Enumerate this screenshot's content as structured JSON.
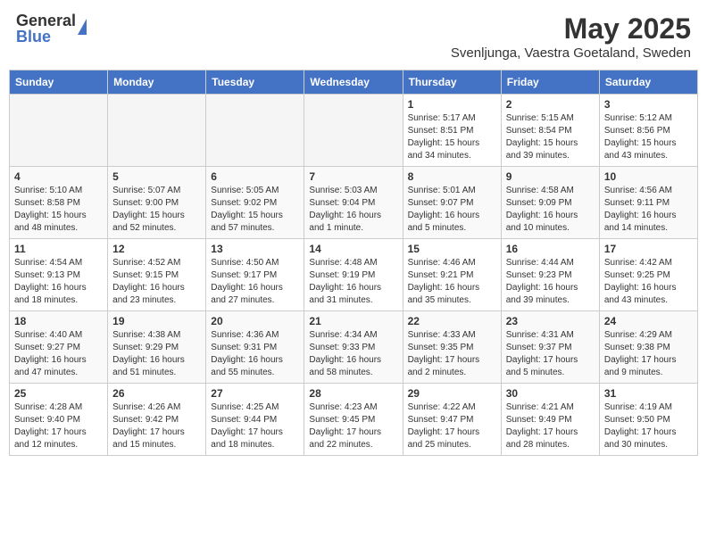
{
  "header": {
    "logo_general": "General",
    "logo_blue": "Blue",
    "month_title": "May 2025",
    "subtitle": "Svenljunga, Vaestra Goetaland, Sweden"
  },
  "weekdays": [
    "Sunday",
    "Monday",
    "Tuesday",
    "Wednesday",
    "Thursday",
    "Friday",
    "Saturday"
  ],
  "weeks": [
    [
      {
        "day": "",
        "empty": true
      },
      {
        "day": "",
        "empty": true
      },
      {
        "day": "",
        "empty": true
      },
      {
        "day": "",
        "empty": true
      },
      {
        "day": "1",
        "sunrise": "Sunrise: 5:17 AM",
        "sunset": "Sunset: 8:51 PM",
        "daylight": "Daylight: 15 hours and 34 minutes."
      },
      {
        "day": "2",
        "sunrise": "Sunrise: 5:15 AM",
        "sunset": "Sunset: 8:54 PM",
        "daylight": "Daylight: 15 hours and 39 minutes."
      },
      {
        "day": "3",
        "sunrise": "Sunrise: 5:12 AM",
        "sunset": "Sunset: 8:56 PM",
        "daylight": "Daylight: 15 hours and 43 minutes."
      }
    ],
    [
      {
        "day": "4",
        "sunrise": "Sunrise: 5:10 AM",
        "sunset": "Sunset: 8:58 PM",
        "daylight": "Daylight: 15 hours and 48 minutes."
      },
      {
        "day": "5",
        "sunrise": "Sunrise: 5:07 AM",
        "sunset": "Sunset: 9:00 PM",
        "daylight": "Daylight: 15 hours and 52 minutes."
      },
      {
        "day": "6",
        "sunrise": "Sunrise: 5:05 AM",
        "sunset": "Sunset: 9:02 PM",
        "daylight": "Daylight: 15 hours and 57 minutes."
      },
      {
        "day": "7",
        "sunrise": "Sunrise: 5:03 AM",
        "sunset": "Sunset: 9:04 PM",
        "daylight": "Daylight: 16 hours and 1 minute."
      },
      {
        "day": "8",
        "sunrise": "Sunrise: 5:01 AM",
        "sunset": "Sunset: 9:07 PM",
        "daylight": "Daylight: 16 hours and 5 minutes."
      },
      {
        "day": "9",
        "sunrise": "Sunrise: 4:58 AM",
        "sunset": "Sunset: 9:09 PM",
        "daylight": "Daylight: 16 hours and 10 minutes."
      },
      {
        "day": "10",
        "sunrise": "Sunrise: 4:56 AM",
        "sunset": "Sunset: 9:11 PM",
        "daylight": "Daylight: 16 hours and 14 minutes."
      }
    ],
    [
      {
        "day": "11",
        "sunrise": "Sunrise: 4:54 AM",
        "sunset": "Sunset: 9:13 PM",
        "daylight": "Daylight: 16 hours and 18 minutes."
      },
      {
        "day": "12",
        "sunrise": "Sunrise: 4:52 AM",
        "sunset": "Sunset: 9:15 PM",
        "daylight": "Daylight: 16 hours and 23 minutes."
      },
      {
        "day": "13",
        "sunrise": "Sunrise: 4:50 AM",
        "sunset": "Sunset: 9:17 PM",
        "daylight": "Daylight: 16 hours and 27 minutes."
      },
      {
        "day": "14",
        "sunrise": "Sunrise: 4:48 AM",
        "sunset": "Sunset: 9:19 PM",
        "daylight": "Daylight: 16 hours and 31 minutes."
      },
      {
        "day": "15",
        "sunrise": "Sunrise: 4:46 AM",
        "sunset": "Sunset: 9:21 PM",
        "daylight": "Daylight: 16 hours and 35 minutes."
      },
      {
        "day": "16",
        "sunrise": "Sunrise: 4:44 AM",
        "sunset": "Sunset: 9:23 PM",
        "daylight": "Daylight: 16 hours and 39 minutes."
      },
      {
        "day": "17",
        "sunrise": "Sunrise: 4:42 AM",
        "sunset": "Sunset: 9:25 PM",
        "daylight": "Daylight: 16 hours and 43 minutes."
      }
    ],
    [
      {
        "day": "18",
        "sunrise": "Sunrise: 4:40 AM",
        "sunset": "Sunset: 9:27 PM",
        "daylight": "Daylight: 16 hours and 47 minutes."
      },
      {
        "day": "19",
        "sunrise": "Sunrise: 4:38 AM",
        "sunset": "Sunset: 9:29 PM",
        "daylight": "Daylight: 16 hours and 51 minutes."
      },
      {
        "day": "20",
        "sunrise": "Sunrise: 4:36 AM",
        "sunset": "Sunset: 9:31 PM",
        "daylight": "Daylight: 16 hours and 55 minutes."
      },
      {
        "day": "21",
        "sunrise": "Sunrise: 4:34 AM",
        "sunset": "Sunset: 9:33 PM",
        "daylight": "Daylight: 16 hours and 58 minutes."
      },
      {
        "day": "22",
        "sunrise": "Sunrise: 4:33 AM",
        "sunset": "Sunset: 9:35 PM",
        "daylight": "Daylight: 17 hours and 2 minutes."
      },
      {
        "day": "23",
        "sunrise": "Sunrise: 4:31 AM",
        "sunset": "Sunset: 9:37 PM",
        "daylight": "Daylight: 17 hours and 5 minutes."
      },
      {
        "day": "24",
        "sunrise": "Sunrise: 4:29 AM",
        "sunset": "Sunset: 9:38 PM",
        "daylight": "Daylight: 17 hours and 9 minutes."
      }
    ],
    [
      {
        "day": "25",
        "sunrise": "Sunrise: 4:28 AM",
        "sunset": "Sunset: 9:40 PM",
        "daylight": "Daylight: 17 hours and 12 minutes."
      },
      {
        "day": "26",
        "sunrise": "Sunrise: 4:26 AM",
        "sunset": "Sunset: 9:42 PM",
        "daylight": "Daylight: 17 hours and 15 minutes."
      },
      {
        "day": "27",
        "sunrise": "Sunrise: 4:25 AM",
        "sunset": "Sunset: 9:44 PM",
        "daylight": "Daylight: 17 hours and 18 minutes."
      },
      {
        "day": "28",
        "sunrise": "Sunrise: 4:23 AM",
        "sunset": "Sunset: 9:45 PM",
        "daylight": "Daylight: 17 hours and 22 minutes."
      },
      {
        "day": "29",
        "sunrise": "Sunrise: 4:22 AM",
        "sunset": "Sunset: 9:47 PM",
        "daylight": "Daylight: 17 hours and 25 minutes."
      },
      {
        "day": "30",
        "sunrise": "Sunrise: 4:21 AM",
        "sunset": "Sunset: 9:49 PM",
        "daylight": "Daylight: 17 hours and 28 minutes."
      },
      {
        "day": "31",
        "sunrise": "Sunrise: 4:19 AM",
        "sunset": "Sunset: 9:50 PM",
        "daylight": "Daylight: 17 hours and 30 minutes."
      }
    ]
  ]
}
